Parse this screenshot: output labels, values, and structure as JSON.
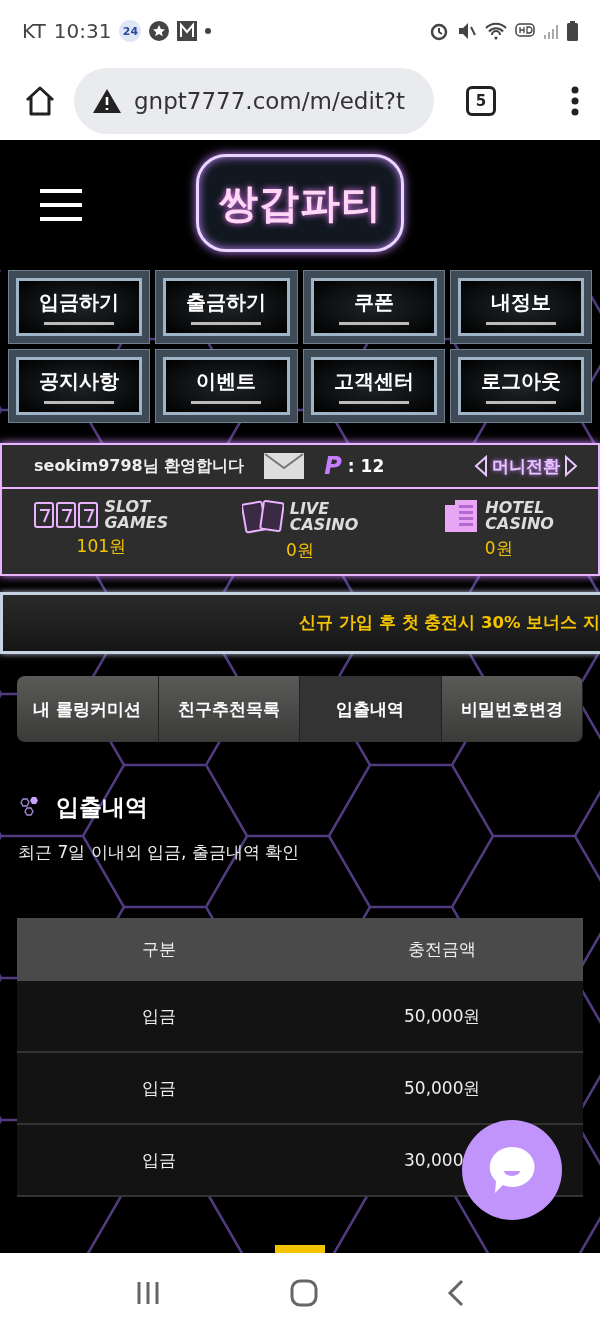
{
  "status_bar": {
    "carrier": "KT",
    "time": "10:31",
    "badge": "24"
  },
  "browser": {
    "url": "gnpt7777.com/m/edit?t",
    "tab_count": "5"
  },
  "header": {
    "logo_text": "쌍갑파티"
  },
  "menu_buttons": [
    "입금하기",
    "출금하기",
    "쿠폰",
    "내정보",
    "공지사항",
    "이벤트",
    "고객센터",
    "로그아웃"
  ],
  "account": {
    "welcome": "seokim9798님 환영합니다",
    "points_label": "P",
    "points": ": 12",
    "money_transfer": "머니전환",
    "games": [
      {
        "kind": "slot",
        "title": [
          "SLOT",
          "GAMES"
        ],
        "balance": "101원"
      },
      {
        "kind": "cards",
        "title": [
          "LIVE",
          "CASINO"
        ],
        "balance": "0원"
      },
      {
        "kind": "hotel",
        "title": [
          "HOTEL",
          "CASINO"
        ],
        "balance": "0원"
      }
    ]
  },
  "marquee": "신규 가입 후 첫 충전시 30% 보너스 지",
  "tabs": [
    {
      "label": "내 롤링커미션",
      "selected": false
    },
    {
      "label": "친구추천목록",
      "selected": false
    },
    {
      "label": "입출내역",
      "selected": true
    },
    {
      "label": "비밀번호변경",
      "selected": false
    }
  ],
  "section": {
    "title": "입출내역",
    "description": "최근 7일 이내외 입금, 출금내역 확인"
  },
  "table": {
    "columns": [
      "구분",
      "충전금액"
    ],
    "rows": [
      [
        "입금",
        "50,000원"
      ],
      [
        "입금",
        "50,000원"
      ],
      [
        "입금",
        "30,000"
      ]
    ]
  }
}
